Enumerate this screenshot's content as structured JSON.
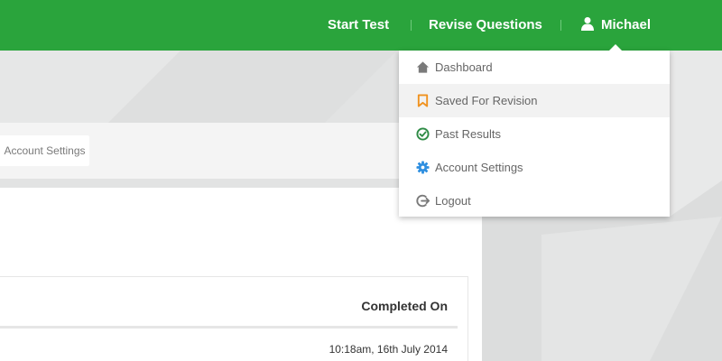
{
  "nav": {
    "start_test": "Start Test",
    "revise_questions": "Revise Questions",
    "user_name": "Michael"
  },
  "dropdown": {
    "items": [
      {
        "label": "Dashboard",
        "icon": "home-icon",
        "color": "#7a7a7a"
      },
      {
        "label": "Saved For Revision",
        "icon": "bookmark-icon",
        "color": "#f0921f",
        "active": true
      },
      {
        "label": "Past Results",
        "icon": "check-circle-icon",
        "color": "#2e8b45"
      },
      {
        "label": "Account Settings",
        "icon": "gear-icon",
        "color": "#2f8fe0"
      },
      {
        "label": "Logout",
        "icon": "logout-icon",
        "color": "#7a7a7a"
      }
    ]
  },
  "page": {
    "tab_account_settings": "Account Settings"
  },
  "table": {
    "header_completed_on": "Completed On",
    "rows": [
      {
        "completed_on": "10:18am, 16th July 2014"
      }
    ]
  },
  "colors": {
    "brand_green": "#2aa43c",
    "background": "#e2e3e3"
  }
}
